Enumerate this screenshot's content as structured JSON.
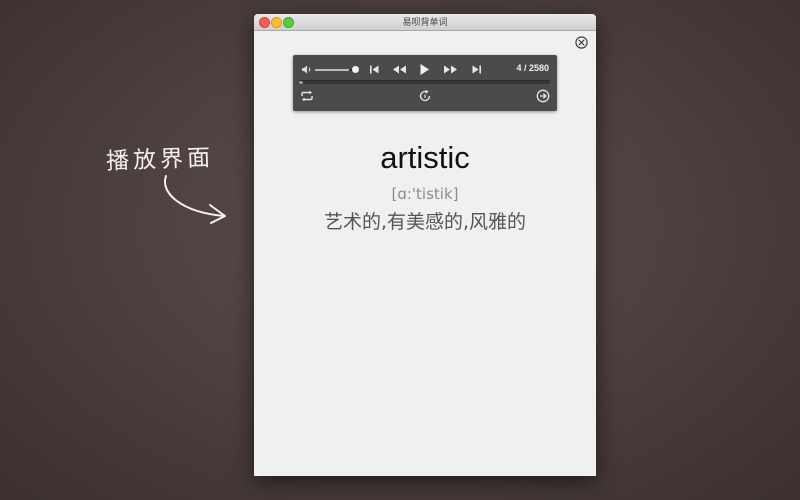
{
  "annotation": {
    "text": "播放界面"
  },
  "window": {
    "title": "易呗背单词"
  },
  "player": {
    "counter": "4 / 2580",
    "volume_fraction": 0.9,
    "progress_fraction": 0.01
  },
  "word": {
    "text": "artistic",
    "phonetic": "[ɑ:'tistik]",
    "meaning": "艺术的,有美感的,风雅的"
  },
  "colors": {
    "background": "#4e4140",
    "player_bg": "#4b4b4b",
    "window_bg": "#f0f0f0"
  },
  "icons": [
    "volume-icon",
    "skip-back-icon",
    "rewind-icon",
    "play-icon",
    "fast-forward-icon",
    "skip-forward-icon",
    "repeat-icon",
    "refresh-icon",
    "next-circle-icon",
    "close-circle-icon",
    "traffic-lights"
  ]
}
